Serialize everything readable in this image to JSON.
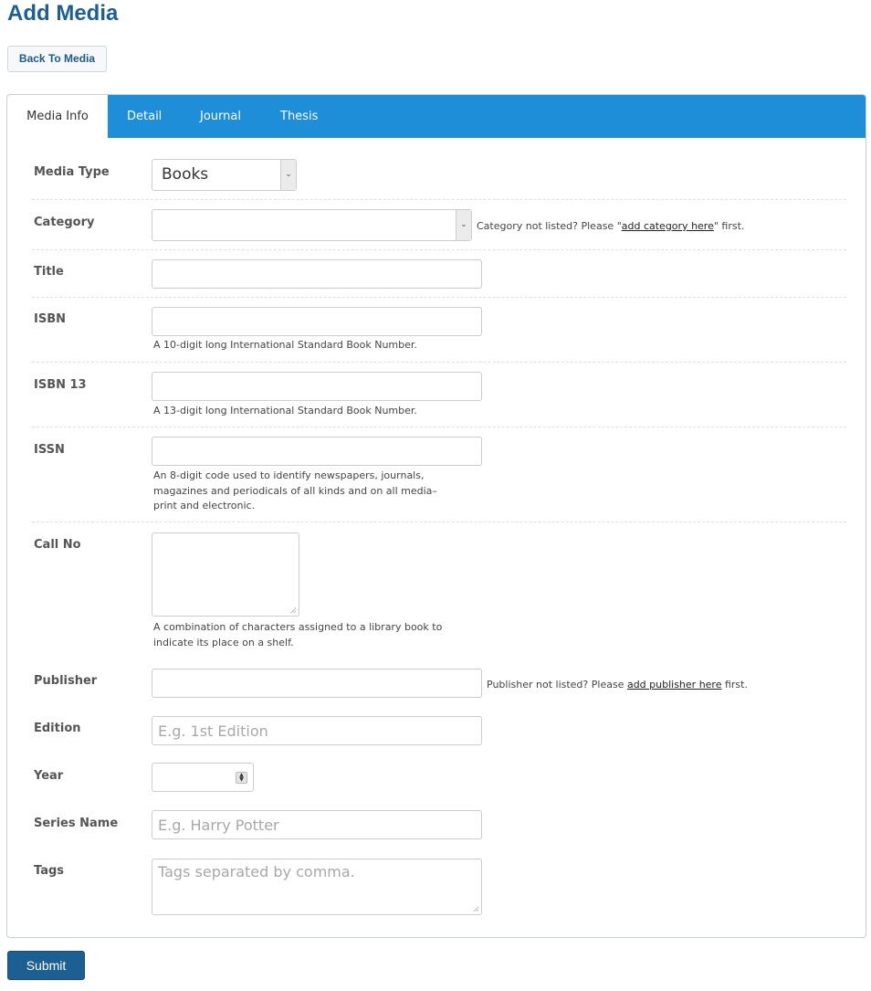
{
  "page": {
    "title": "Add Media",
    "back_label": "Back To Media",
    "submit_label": "Submit"
  },
  "tabs": [
    {
      "label": "Media Info",
      "active": true
    },
    {
      "label": "Detail",
      "active": false
    },
    {
      "label": "Journal",
      "active": false
    },
    {
      "label": "Thesis",
      "active": false
    }
  ],
  "colors": {
    "accent": "#1f8ed9",
    "brand": "#1b5f93"
  },
  "form": {
    "media_type": {
      "label": "Media Type",
      "value": "Books"
    },
    "category": {
      "label": "Category",
      "value": "",
      "note_prefix": "Category not listed? Please \"",
      "note_link": "add category here",
      "note_suffix": "\" first."
    },
    "title": {
      "label": "Title",
      "value": ""
    },
    "isbn": {
      "label": "ISBN",
      "value": "",
      "help": "A 10-digit long International Standard Book Number."
    },
    "isbn13": {
      "label": "ISBN 13",
      "value": "",
      "help": "A 13-digit long International Standard Book Number."
    },
    "issn": {
      "label": "ISSN",
      "value": "",
      "help": "An 8-digit code used to identify newspapers, journals, magazines and periodicals of all kinds and on all media–print and electronic."
    },
    "call_no": {
      "label": "Call No",
      "value": "",
      "help": "A combination of characters assigned to a library book to indicate its place on a shelf."
    },
    "publisher": {
      "label": "Publisher",
      "value": "",
      "note_prefix": "Publisher not listed? Please ",
      "note_link": "add publisher here",
      "note_suffix": " first."
    },
    "edition": {
      "label": "Edition",
      "value": "",
      "placeholder": "E.g. 1st Edition"
    },
    "year": {
      "label": "Year",
      "value": ""
    },
    "series_name": {
      "label": "Series Name",
      "value": "",
      "placeholder": "E.g. Harry Potter"
    },
    "tags": {
      "label": "Tags",
      "value": "",
      "placeholder": "Tags separated by comma."
    }
  }
}
